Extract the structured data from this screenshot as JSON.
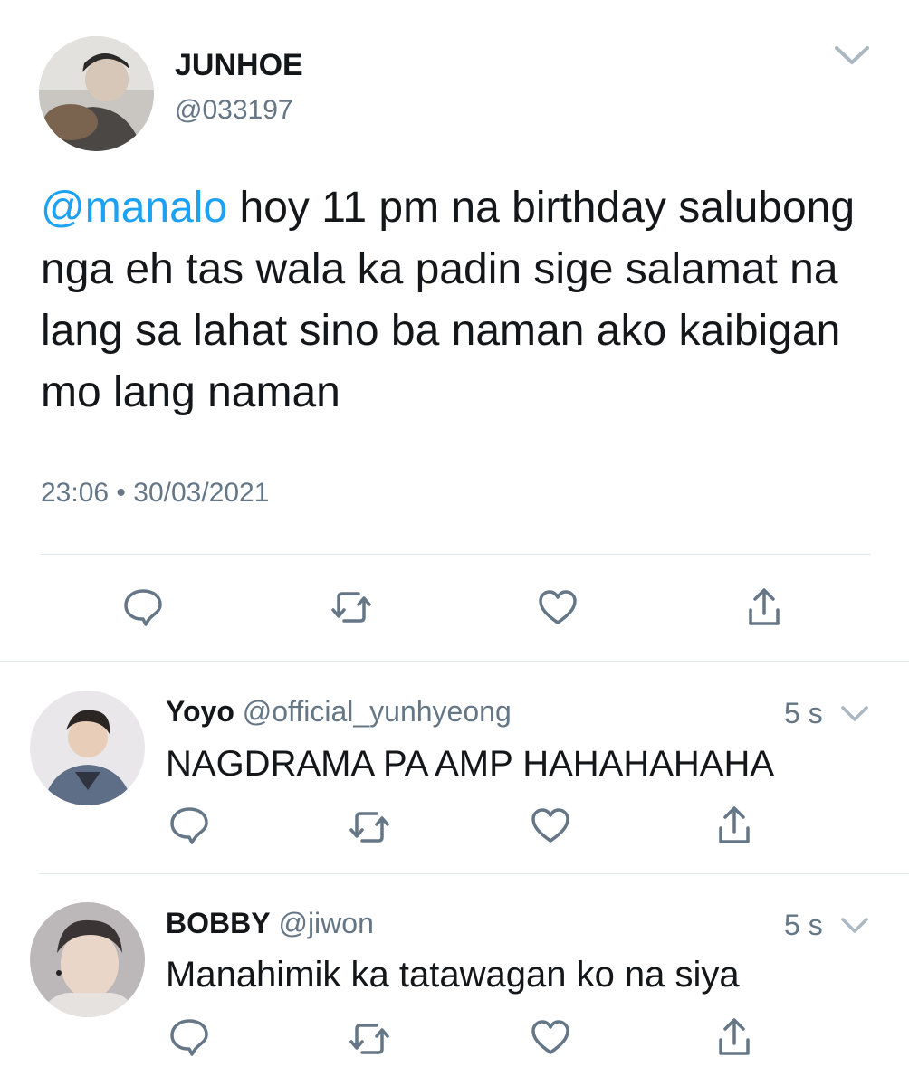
{
  "main_tweet": {
    "name": "JUNHOE",
    "handle": "@033197",
    "mention": "@manalo",
    "text": " hoy 11 pm na birthday salubong nga eh tas wala ka padin sige salamat na lang sa lahat sino ba naman ako kaibigan mo lang naman",
    "time": "23:06",
    "separator": "•",
    "date": "30/03/2021",
    "actions": [
      "reply-icon",
      "retweet-icon",
      "like-icon",
      "share-icon"
    ]
  },
  "replies": [
    {
      "name": "Yoyo",
      "handle": "@official_yunhyeong",
      "time": "5 s",
      "text": "NAGDRAMA PA AMP HAHAHAHAHA"
    },
    {
      "name": "BOBBY",
      "handle": "@jiwon",
      "time": "5 s",
      "text": "Manahimik ka tatawagan ko na siya"
    }
  ],
  "colors": {
    "mention": "#1da1f2",
    "secondary_text": "#657786",
    "icon": "#657786",
    "divider": "#e1e8ed"
  }
}
